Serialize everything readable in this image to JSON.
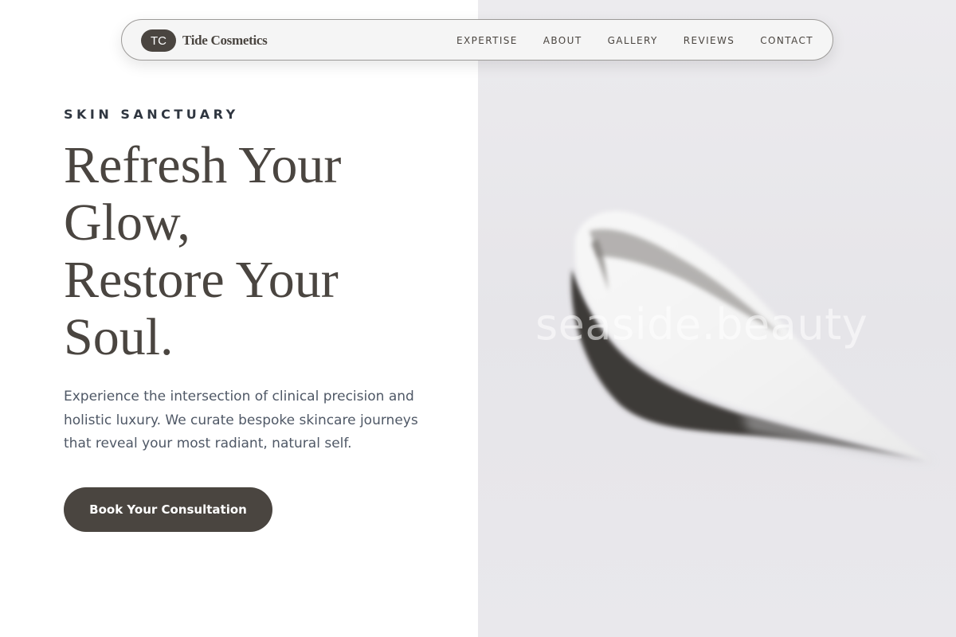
{
  "brand": {
    "logo_text": "TC",
    "name": "Tide Cosmetics"
  },
  "nav": {
    "items": [
      {
        "label": "EXPERTISE"
      },
      {
        "label": "ABOUT"
      },
      {
        "label": "GALLERY"
      },
      {
        "label": "REVIEWS"
      },
      {
        "label": "CONTACT"
      }
    ]
  },
  "hero": {
    "eyebrow": "SKIN SANCTUARY",
    "headline_lines": [
      "Refresh Your",
      "Glow,",
      "Restore Your",
      "Soul."
    ],
    "intro": "Experience the intersection of clinical precision and holistic luxury. We curate bespoke skincare journeys that reveal your most radiant, natural self.",
    "cta_label": "Book Your Consultation"
  },
  "hero_image": {
    "watermark": "seaside.beauty"
  },
  "colors": {
    "primary": "#4a4540",
    "eyebrow": "#2f3640",
    "body_text": "#4f5866",
    "image_background": "#e8e7eb"
  }
}
